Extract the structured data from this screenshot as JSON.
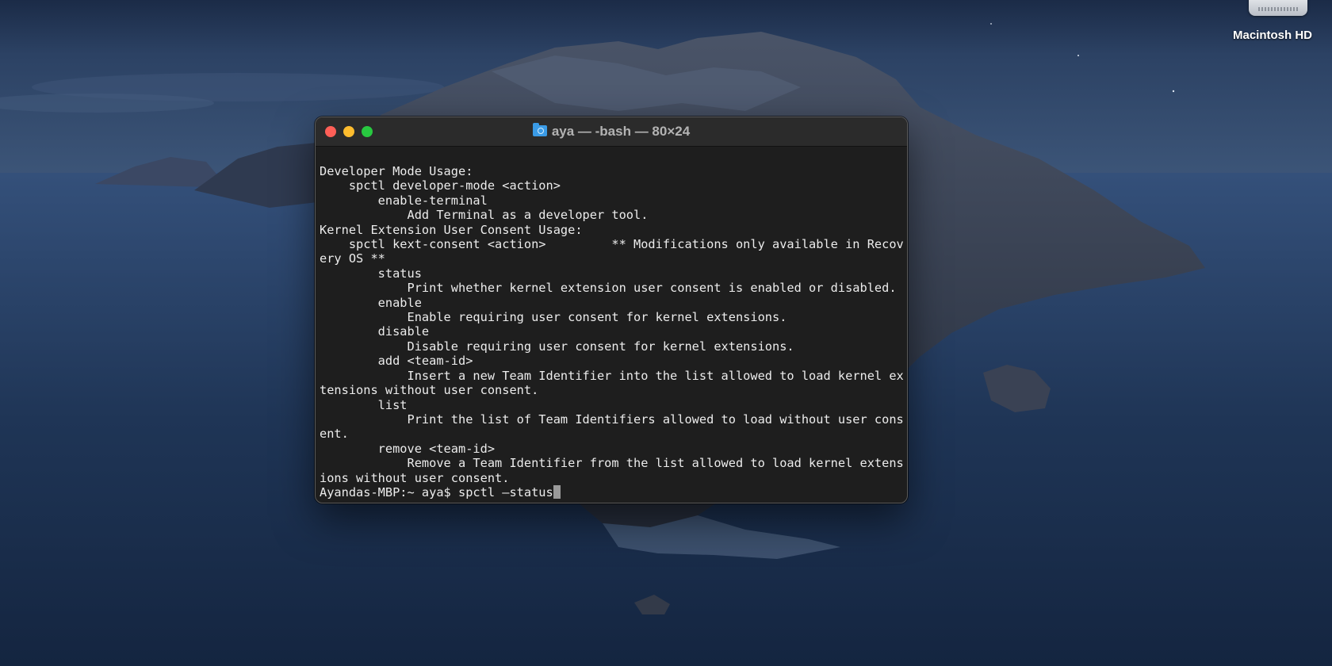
{
  "desktop": {
    "drive_label": "Macintosh HD"
  },
  "window": {
    "title": "aya — -bash — 80×24",
    "traffic_lights": {
      "close_color": "#ff5f57",
      "minimize_color": "#febc2e",
      "zoom_color": "#28c840"
    },
    "title_icon": "folder-icon"
  },
  "terminal": {
    "lines": [
      "Developer Mode Usage:",
      "    spctl developer-mode <action>",
      "        enable-terminal",
      "            Add Terminal as a developer tool.",
      "Kernel Extension User Consent Usage:",
      "    spctl kext-consent <action>         ** Modifications only available in Recov",
      "ery OS **",
      "        status",
      "            Print whether kernel extension user consent is enabled or disabled.",
      "        enable",
      "            Enable requiring user consent for kernel extensions.",
      "        disable",
      "            Disable requiring user consent for kernel extensions.",
      "        add <team-id>",
      "            Insert a new Team Identifier into the list allowed to load kernel ex",
      "tensions without user consent.",
      "        list",
      "            Print the list of Team Identifiers allowed to load without user cons",
      "ent.",
      "        remove <team-id>",
      "            Remove a Team Identifier from the list allowed to load kernel extens",
      "ions without user consent."
    ],
    "prompt": "Ayandas-MBP:~ aya$ ",
    "command": "spctl —status"
  }
}
